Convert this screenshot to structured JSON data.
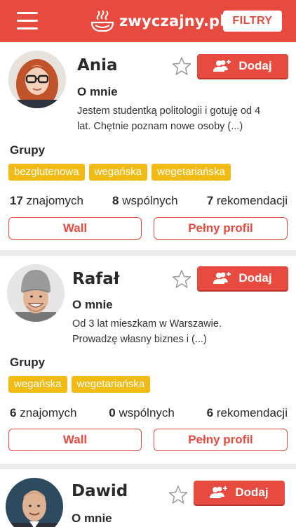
{
  "app": {
    "brand": "zwyczajny.pl",
    "filter_label": "FILTRY",
    "colors": {
      "accent": "#e74a3f",
      "tag": "#f2bb13"
    }
  },
  "profiles": [
    {
      "name": "Ania",
      "add_label": "Dodaj",
      "about_heading": "O mnie",
      "about_line1": "Jestem studentką politologii i gotuję od 4",
      "about_line2": "lat. Chętnie poznam nowe osoby (...)",
      "groups_heading": "Grupy",
      "tags": [
        "bezglutenowa",
        "wegańska",
        "wegetariańska"
      ],
      "friends_count": "17",
      "friends_label": "znajomych",
      "common_count": "8",
      "common_label": "wspólnych",
      "recs_count": "7",
      "recs_label": "rekomendacji",
      "wall_label": "Wall",
      "profile_label": "Pełny profil"
    },
    {
      "name": "Rafał",
      "add_label": "Dodaj",
      "about_heading": "O mnie",
      "about_line1": "Od 3 lat mieszkam w Warszawie.",
      "about_line2": "Prowadzę własny biznes i (...)",
      "groups_heading": "Grupy",
      "tags": [
        "wegańska",
        "wegetariańska"
      ],
      "friends_count": "6",
      "friends_label": "znajomych",
      "common_count": "0",
      "common_label": "wspólnych",
      "recs_count": "6",
      "recs_label": "rekomendacji",
      "wall_label": "Wall",
      "profile_label": "Pełny profil"
    },
    {
      "name": "Dawid",
      "add_label": "Dodaj",
      "about_heading": "O mnie"
    }
  ]
}
